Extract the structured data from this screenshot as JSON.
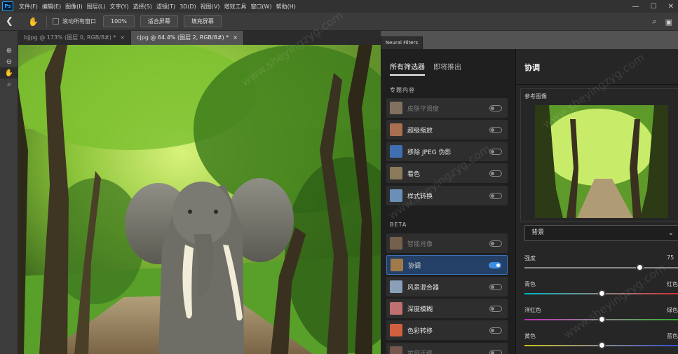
{
  "menu": {
    "logo": "Ps",
    "items": [
      "文件(F)",
      "编辑(E)",
      "图像(I)",
      "图层(L)",
      "文字(Y)",
      "选择(S)",
      "滤镜(T)",
      "3D(D)",
      "视图(V)",
      "增效工具",
      "窗口(W)",
      "帮助(H)"
    ],
    "minimize": "—",
    "maximize": "☐",
    "close": "✕"
  },
  "options": {
    "scroll_all_windows": "滚动所有窗口",
    "zoom_value": "100%",
    "fit_screen": "适合屏幕",
    "fill_screen": "填充屏幕",
    "search_icon": "search-icon",
    "workspace_icon": "workspace-icon"
  },
  "tabs": [
    {
      "label": "bjjpg @ 173% (图层 0, RGB/8#) *",
      "close": "×"
    },
    {
      "label": "cjpg @ 64.4% (图层 2, RGB/8#) *",
      "close": "×"
    }
  ],
  "toolbar": {
    "tools": [
      "zoom-in-icon",
      "zoom-out-icon",
      "hand-icon",
      "magnifier-icon"
    ]
  },
  "neural_filters": {
    "panel_tab": "Neural Filters",
    "tabs": [
      "所有筛选器",
      "即将推出"
    ],
    "section_featured": "专题内容",
    "featured": [
      {
        "label": "皮肤平滑度",
        "enabled": false,
        "dim": true,
        "thumb": "#c9a98a"
      },
      {
        "label": "超级缩放",
        "enabled": false,
        "dim": false,
        "thumb": "#a87050"
      },
      {
        "label": "移除 JPEG 伪影",
        "enabled": false,
        "dim": false,
        "thumb": "#3f6fb0"
      },
      {
        "label": "着色",
        "enabled": false,
        "dim": false,
        "thumb": "#8a7a5a"
      },
      {
        "label": "样式转换",
        "enabled": false,
        "dim": false,
        "thumb": "#6a90b8"
      }
    ],
    "section_beta": "BETA",
    "beta": [
      {
        "label": "智能肖像",
        "enabled": false,
        "dim": true,
        "thumb": "#b08a6a"
      },
      {
        "label": "协调",
        "enabled": true,
        "dim": false,
        "thumb": "#a07a4a"
      },
      {
        "label": "风景混合器",
        "enabled": false,
        "dim": false,
        "thumb": "#8aa0b8"
      },
      {
        "label": "深度模糊",
        "enabled": false,
        "dim": false,
        "thumb": "#c07070"
      },
      {
        "label": "色彩转移",
        "enabled": false,
        "dim": false,
        "thumb": "#d06040"
      },
      {
        "label": "妆容迁移",
        "enabled": false,
        "dim": true,
        "thumb": "#b07a6a"
      }
    ]
  },
  "harmonize": {
    "title": "协调",
    "reference_label": "参考图像",
    "dropdown_value": "背景",
    "sliders": [
      {
        "left": "强度",
        "right": "75",
        "value": 0.75,
        "color": "#9a9a9a"
      },
      {
        "left": "青色",
        "right": "红色",
        "value": 0.5,
        "color": "cyan-red"
      },
      {
        "left": "洋红色",
        "right": "绿色",
        "value": 0.5,
        "color": "magenta-green"
      },
      {
        "left": "黄色",
        "right": "蓝色",
        "value": 0.5,
        "color": "yellow-blue"
      }
    ]
  },
  "watermark": "www.sheyingzyg.com"
}
